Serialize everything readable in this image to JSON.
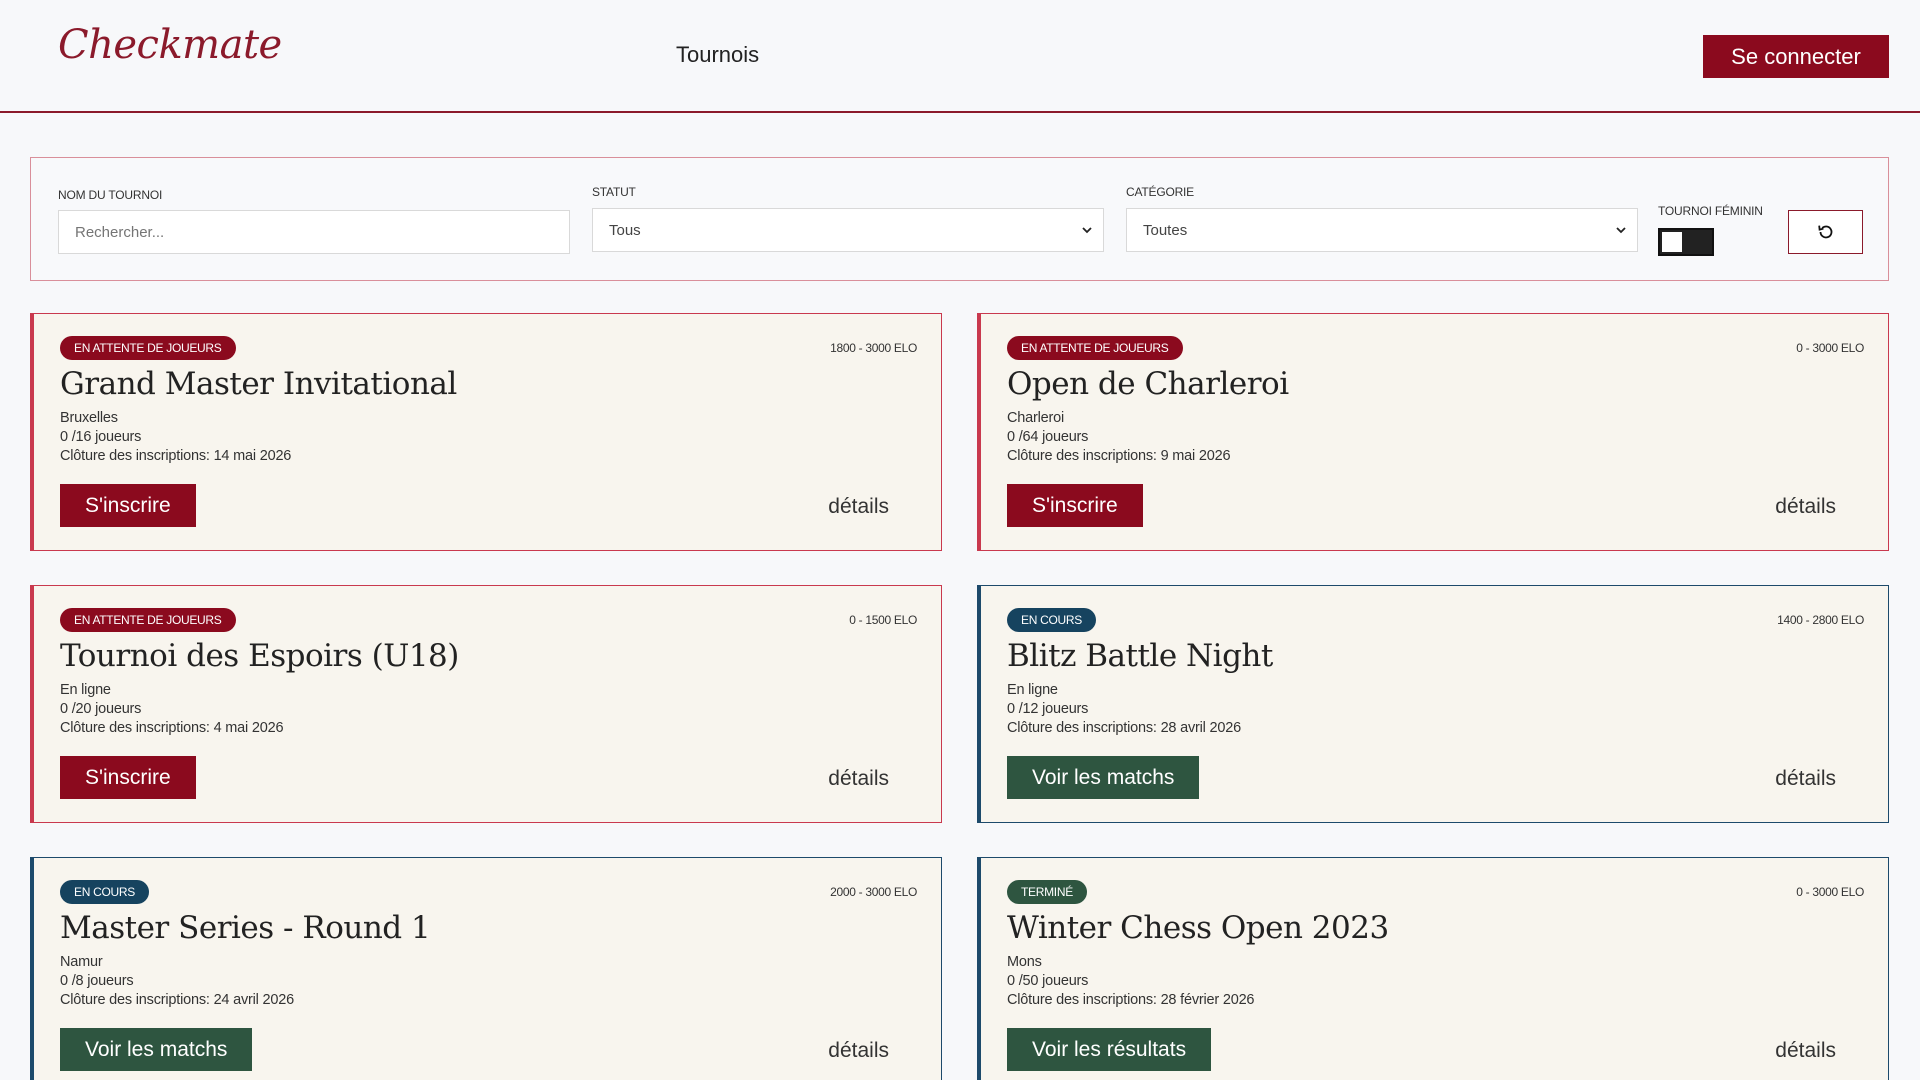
{
  "header": {
    "logo": "Checkmate",
    "nav": "Tournois",
    "login": "Se connecter"
  },
  "filters": {
    "name_label": "NOM DU TOURNOI",
    "name_placeholder": "Rechercher...",
    "status_label": "STATUT",
    "status_value": "Tous",
    "category_label": "CATÉGORIE",
    "category_value": "Toutes",
    "women_label": "TOURNOI FÉMININ",
    "women_enabled": false
  },
  "colors": {
    "primary": "#8b0a1e",
    "status_waiting": "#8b0a1e",
    "status_ongoing": "#16435f",
    "status_finished": "#2e5540",
    "action_green": "#2e5540"
  },
  "labels": {
    "details": "détails"
  },
  "tournaments": [
    {
      "status": "EN ATTENTE DE JOUEURS",
      "elo": "1800 - 3000 ELO",
      "title": "Grand Master Invitational",
      "location": "Bruxelles",
      "players": "0 /16 joueurs",
      "closing": "Clôture des inscriptions: 14 mai 2026",
      "action": "S'inscrire"
    },
    {
      "status": "EN ATTENTE DE JOUEURS",
      "elo": "0 - 3000 ELO",
      "title": "Open de Charleroi",
      "location": "Charleroi",
      "players": "0 /64 joueurs",
      "closing": "Clôture des inscriptions: 9 mai 2026",
      "action": "S'inscrire"
    },
    {
      "status": "EN ATTENTE DE JOUEURS",
      "elo": "0 - 1500 ELO",
      "title": "Tournoi des Espoirs (U18)",
      "location": "En ligne",
      "players": "0 /20 joueurs",
      "closing": "Clôture des inscriptions: 4 mai 2026",
      "action": "S'inscrire"
    },
    {
      "status": "EN COURS",
      "elo": "1400 - 2800 ELO",
      "title": "Blitz Battle Night",
      "location": "En ligne",
      "players": "0 /12 joueurs",
      "closing": "Clôture des inscriptions: 28 avril 2026",
      "action": "Voir les matchs"
    },
    {
      "status": "EN COURS",
      "elo": "2000 - 3000 ELO",
      "title": "Master Series - Round 1",
      "location": "Namur",
      "players": "0 /8 joueurs",
      "closing": "Clôture des inscriptions: 24 avril 2026",
      "action": "Voir les matchs"
    },
    {
      "status": "TERMINÉ",
      "elo": "0 - 3000 ELO",
      "title": "Winter Chess Open 2023",
      "location": "Mons",
      "players": "0 /50 joueurs",
      "closing": "Clôture des inscriptions: 28 février 2026",
      "action": "Voir les résultats"
    }
  ]
}
